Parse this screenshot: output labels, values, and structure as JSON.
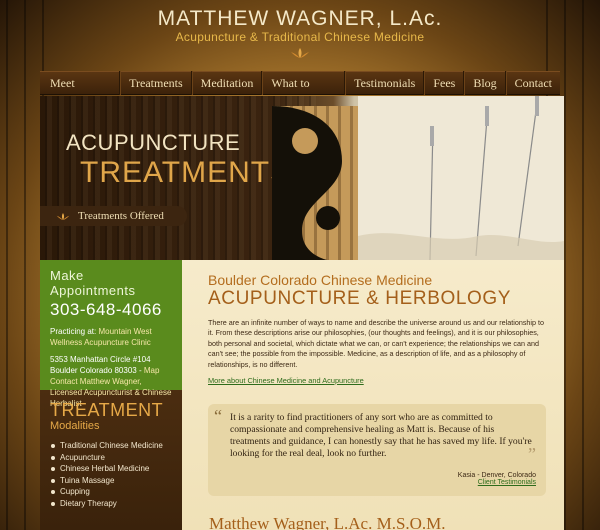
{
  "header": {
    "title": "MATTHEW WAGNER, L.Ac.",
    "subtitle": "Acupuncture & Traditional Chinese Medicine",
    "logo_icon": "lotus-icon"
  },
  "nav": {
    "items": [
      {
        "label": "Meet Matthew"
      },
      {
        "label": "Treatments"
      },
      {
        "label": "Meditation"
      },
      {
        "label": "What to Expect"
      },
      {
        "label": "Testimonials"
      },
      {
        "label": "Fees"
      },
      {
        "label": "Blog"
      },
      {
        "label": "Contact"
      }
    ]
  },
  "hero": {
    "title_line1": "ACUPUNCTURE",
    "title_line2": "TREATMENTS",
    "button_label": "Treatments Offered"
  },
  "sidebar": {
    "appointments": {
      "title": "Make Appointments",
      "phone": "303-648-4066",
      "practicing_prefix": "Practicing at:",
      "practicing_link": "Mountain West Wellness Acupuncture Clinic",
      "address_line1": "5353 Manhattan Circle #104",
      "address_line2": "Boulder Colorado 80303",
      "map_link": "Map",
      "contact_link": "Contact Matthew Wagner, Licensed Acupuncturist & Chinese Herbalist"
    },
    "modalities": {
      "title": "TREATMENT",
      "subtitle": "Modalities",
      "items": [
        "Traditional Chinese Medicine",
        "Acupuncture",
        "Chinese Herbal Medicine",
        "Tuina Massage",
        "Cupping",
        "Dietary Therapy"
      ]
    }
  },
  "main": {
    "kicker": "Boulder Colorado Chinese Medicine",
    "heading": "ACUPUNCTURE & HERBOLOGY",
    "body": "There are an infinite number of ways to name and describe the universe around us and our relationship to it. From these descriptions arise our philosophies, (our thoughts and feelings), and it is our philosophies, both personal and societal, which dictate what we can, or can't experience; the relationships we can and can't see; the possible from the impossible. Medicine, as a description of life, and as a philosophy of relationships, is no different.",
    "more_link": "More about Chinese Medicine and Acupuncture",
    "quote": {
      "text": "It is a rarity to find practitioners of any sort who are as committed to compassionate and comprehensive healing as Matt is. Because of his treatments and guidance, I can honestly say that he has saved my life. If you're looking for the real deal, look no further.",
      "author": "Kasia - Denver, Colorado",
      "link": "Client Testimonials"
    },
    "bottom_title": "Matthew Wagner, L.Ac. M.S.O.M."
  }
}
